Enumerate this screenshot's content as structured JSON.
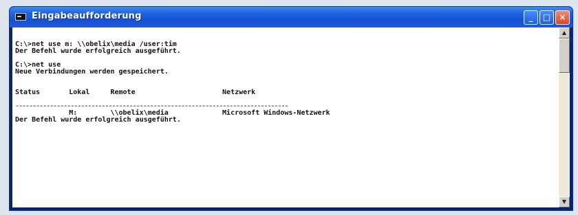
{
  "window": {
    "title": "Eingabeaufforderung",
    "icon": "console-icon",
    "controls": {
      "minimize": "_",
      "maximize": "□",
      "close": "×"
    }
  },
  "console": {
    "lines": [
      "C:\\>net use m: \\\\obelix\\media /user:tim",
      "Der Befehl wurde erfolgreich ausgeführt.",
      "",
      "C:\\>net use",
      "Neue Verbindungen werden gespeichert.",
      "",
      "",
      "Status       Lokal     Remote                     Netzwerk",
      "",
      "-------------------------------------------------------------------------------",
      "             M:        \\\\obelix\\media             Microsoft Windows-Netzwerk",
      "Der Befehl wurde erfolgreich ausgeführt."
    ]
  },
  "scrollbar": {
    "up_glyph": "▲",
    "down_glyph": "▼"
  }
}
